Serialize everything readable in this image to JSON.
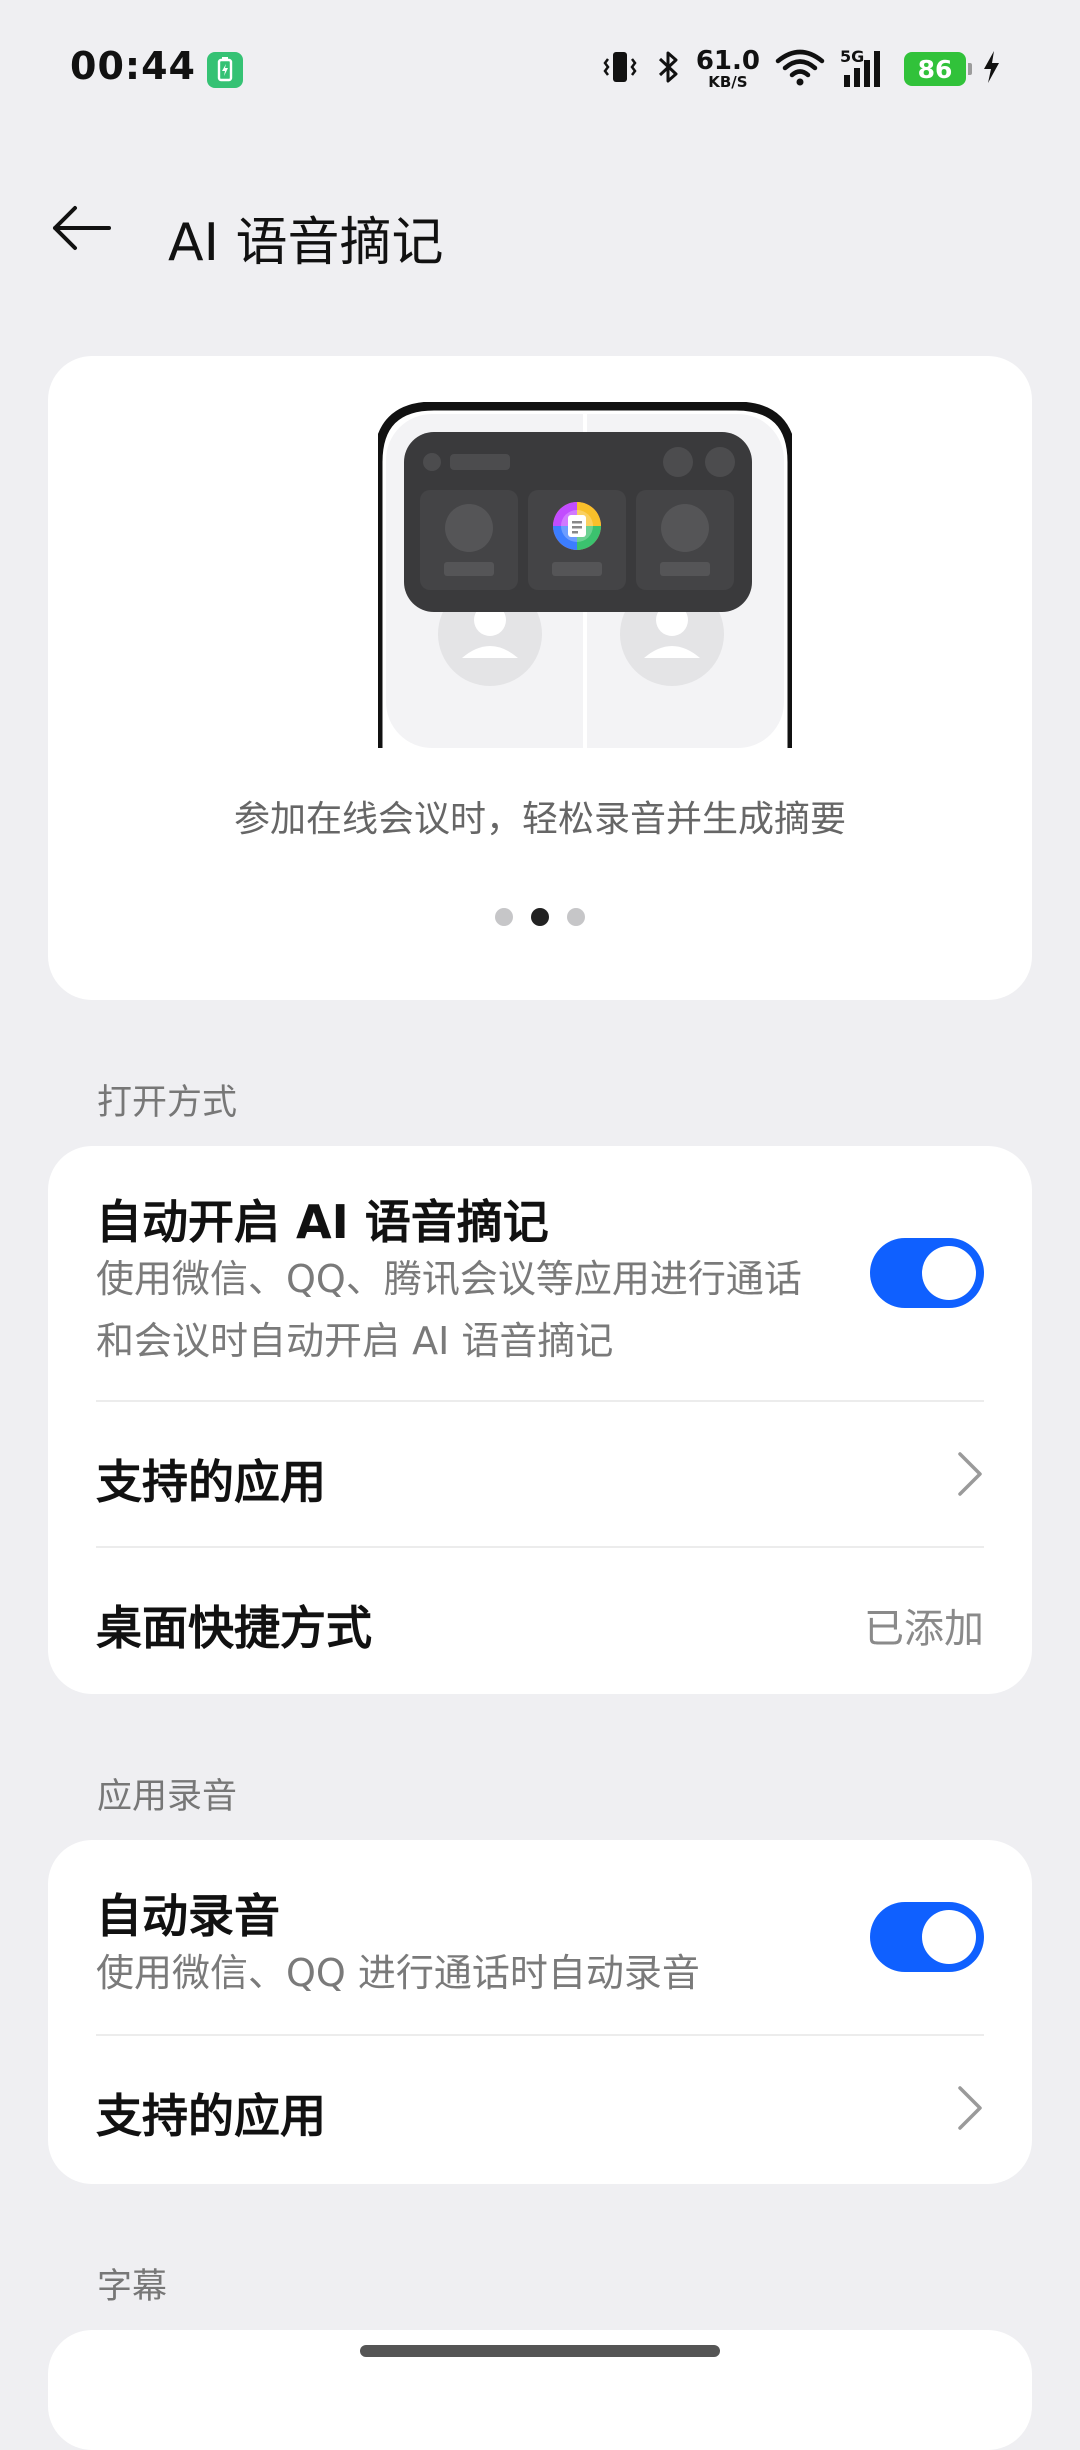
{
  "status_bar": {
    "time": "00:44",
    "net_speed_value": "61.0",
    "net_speed_unit": "KB/S",
    "signal_label": "5G",
    "battery": "86",
    "icons": [
      "battery-saver-icon",
      "vibrate-icon",
      "bluetooth-icon",
      "wifi-icon",
      "cellular-signal-icon",
      "charging-bolt-icon"
    ]
  },
  "header": {
    "title": "AI 语音摘记",
    "back_icon": "back-arrow-icon"
  },
  "hero": {
    "caption": "参加在线会议时，轻松录音并生成摘要",
    "pages": 3,
    "active_page": 2
  },
  "sections": {
    "open_method": {
      "label": "打开方式",
      "auto_enable": {
        "title": "自动开启 AI 语音摘记",
        "description": "使用微信、QQ、腾讯会议等应用进行通话和会议时自动开启 AI 语音摘记",
        "enabled": true
      },
      "supported_apps": {
        "title": "支持的应用"
      },
      "desktop_shortcut": {
        "title": "桌面快捷方式",
        "value": "已添加"
      }
    },
    "app_recording": {
      "label": "应用录音",
      "auto_record": {
        "title": "自动录音",
        "description": "使用微信、QQ 进行通话时自动录音",
        "enabled": true
      },
      "supported_apps": {
        "title": "支持的应用"
      }
    },
    "subtitles": {
      "label": "字幕"
    }
  },
  "colors": {
    "background": "#efeff2",
    "card": "#ffffff",
    "toggle_on": "#0f60ff",
    "battery": "#31c23a",
    "battery_saver": "#35c274"
  }
}
